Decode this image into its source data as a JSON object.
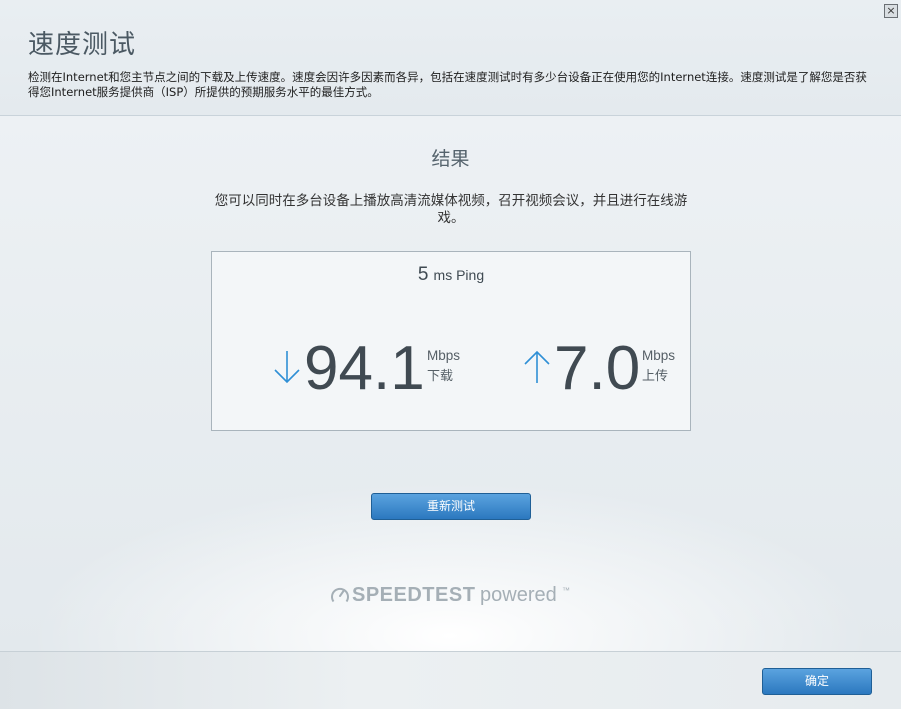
{
  "header": {
    "title": "速度测试",
    "description": "检测在Internet和您主节点之间的下载及上传速度。速度会因许多因素而各异，包括在速度测试时有多少台设备正在使用您的Internet连接。速度测试是了解您是否获得您Internet服务提供商（ISP）所提供的预期服务水平的最佳方式。",
    "close_label": "×"
  },
  "result": {
    "title": "结果",
    "description": "您可以同时在多台设备上播放高清流媒体视频，召开视频会议，并且进行在线游戏。",
    "ping": {
      "value": "5",
      "unit": "ms Ping"
    },
    "download": {
      "value": "94.1",
      "unit": "Mbps",
      "label": "下载",
      "icon": "arrow-down-icon"
    },
    "upload": {
      "value": "7.0",
      "unit": "Mbps",
      "label": "上传",
      "icon": "arrow-up-icon"
    }
  },
  "actions": {
    "retest_label": "重新测试",
    "ok_label": "确定"
  },
  "branding": {
    "brand": "SPEEDTEST",
    "powered": "powered",
    "tm": "™",
    "icon": "speedometer-icon"
  },
  "colors": {
    "accent": "#2f7fc4",
    "arrow": "#2e8fd6"
  }
}
